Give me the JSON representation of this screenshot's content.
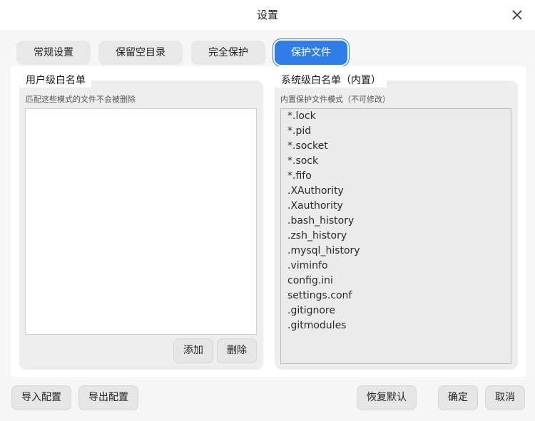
{
  "window": {
    "title": "设置"
  },
  "tabs": [
    {
      "label": "常规设置"
    },
    {
      "label": "保留空目录"
    },
    {
      "label": "完全保护"
    },
    {
      "label": "保护文件"
    }
  ],
  "user_whitelist": {
    "title": "用户级白名单",
    "description": "匹配这些模式的文件不会被删除",
    "items": [],
    "add_label": "添加",
    "delete_label": "删除"
  },
  "system_whitelist": {
    "title": "系统级白名单（内置）",
    "description": "内置保护文件模式（不可修改）",
    "items": [
      "*.lock",
      "*.pid",
      "*.socket",
      "*.sock",
      "*.fifo",
      ".XAuthority",
      ".Xauthority",
      ".bash_history",
      ".zsh_history",
      ".mysql_history",
      ".viminfo",
      "config.ini",
      "settings.conf",
      ".gitignore",
      ".gitmodules"
    ]
  },
  "footer": {
    "import_label": "导入配置",
    "export_label": "导出配置",
    "restore_label": "恢复默认",
    "ok_label": "确定",
    "cancel_label": "取消"
  },
  "colors": {
    "accent": "#2f7de9"
  }
}
